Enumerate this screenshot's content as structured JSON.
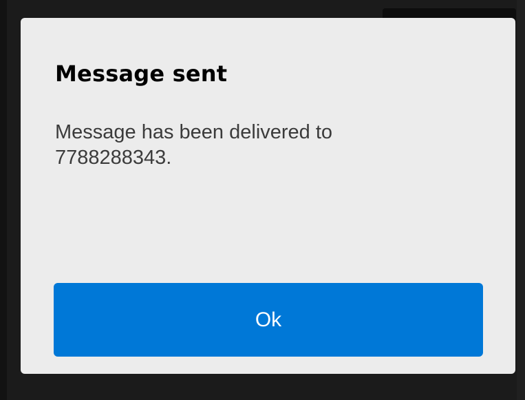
{
  "dialog": {
    "title": "Message sent",
    "message_line1": "Message has been delivered to",
    "message_line2": "7788288343.",
    "ok_label": "Ok"
  },
  "colors": {
    "dialog_background": "#ececec",
    "button_background": "#0078d7",
    "button_text": "#ffffff",
    "title_text": "#000000",
    "body_text": "#3b3b3b",
    "backdrop": "#1b1b1b"
  }
}
